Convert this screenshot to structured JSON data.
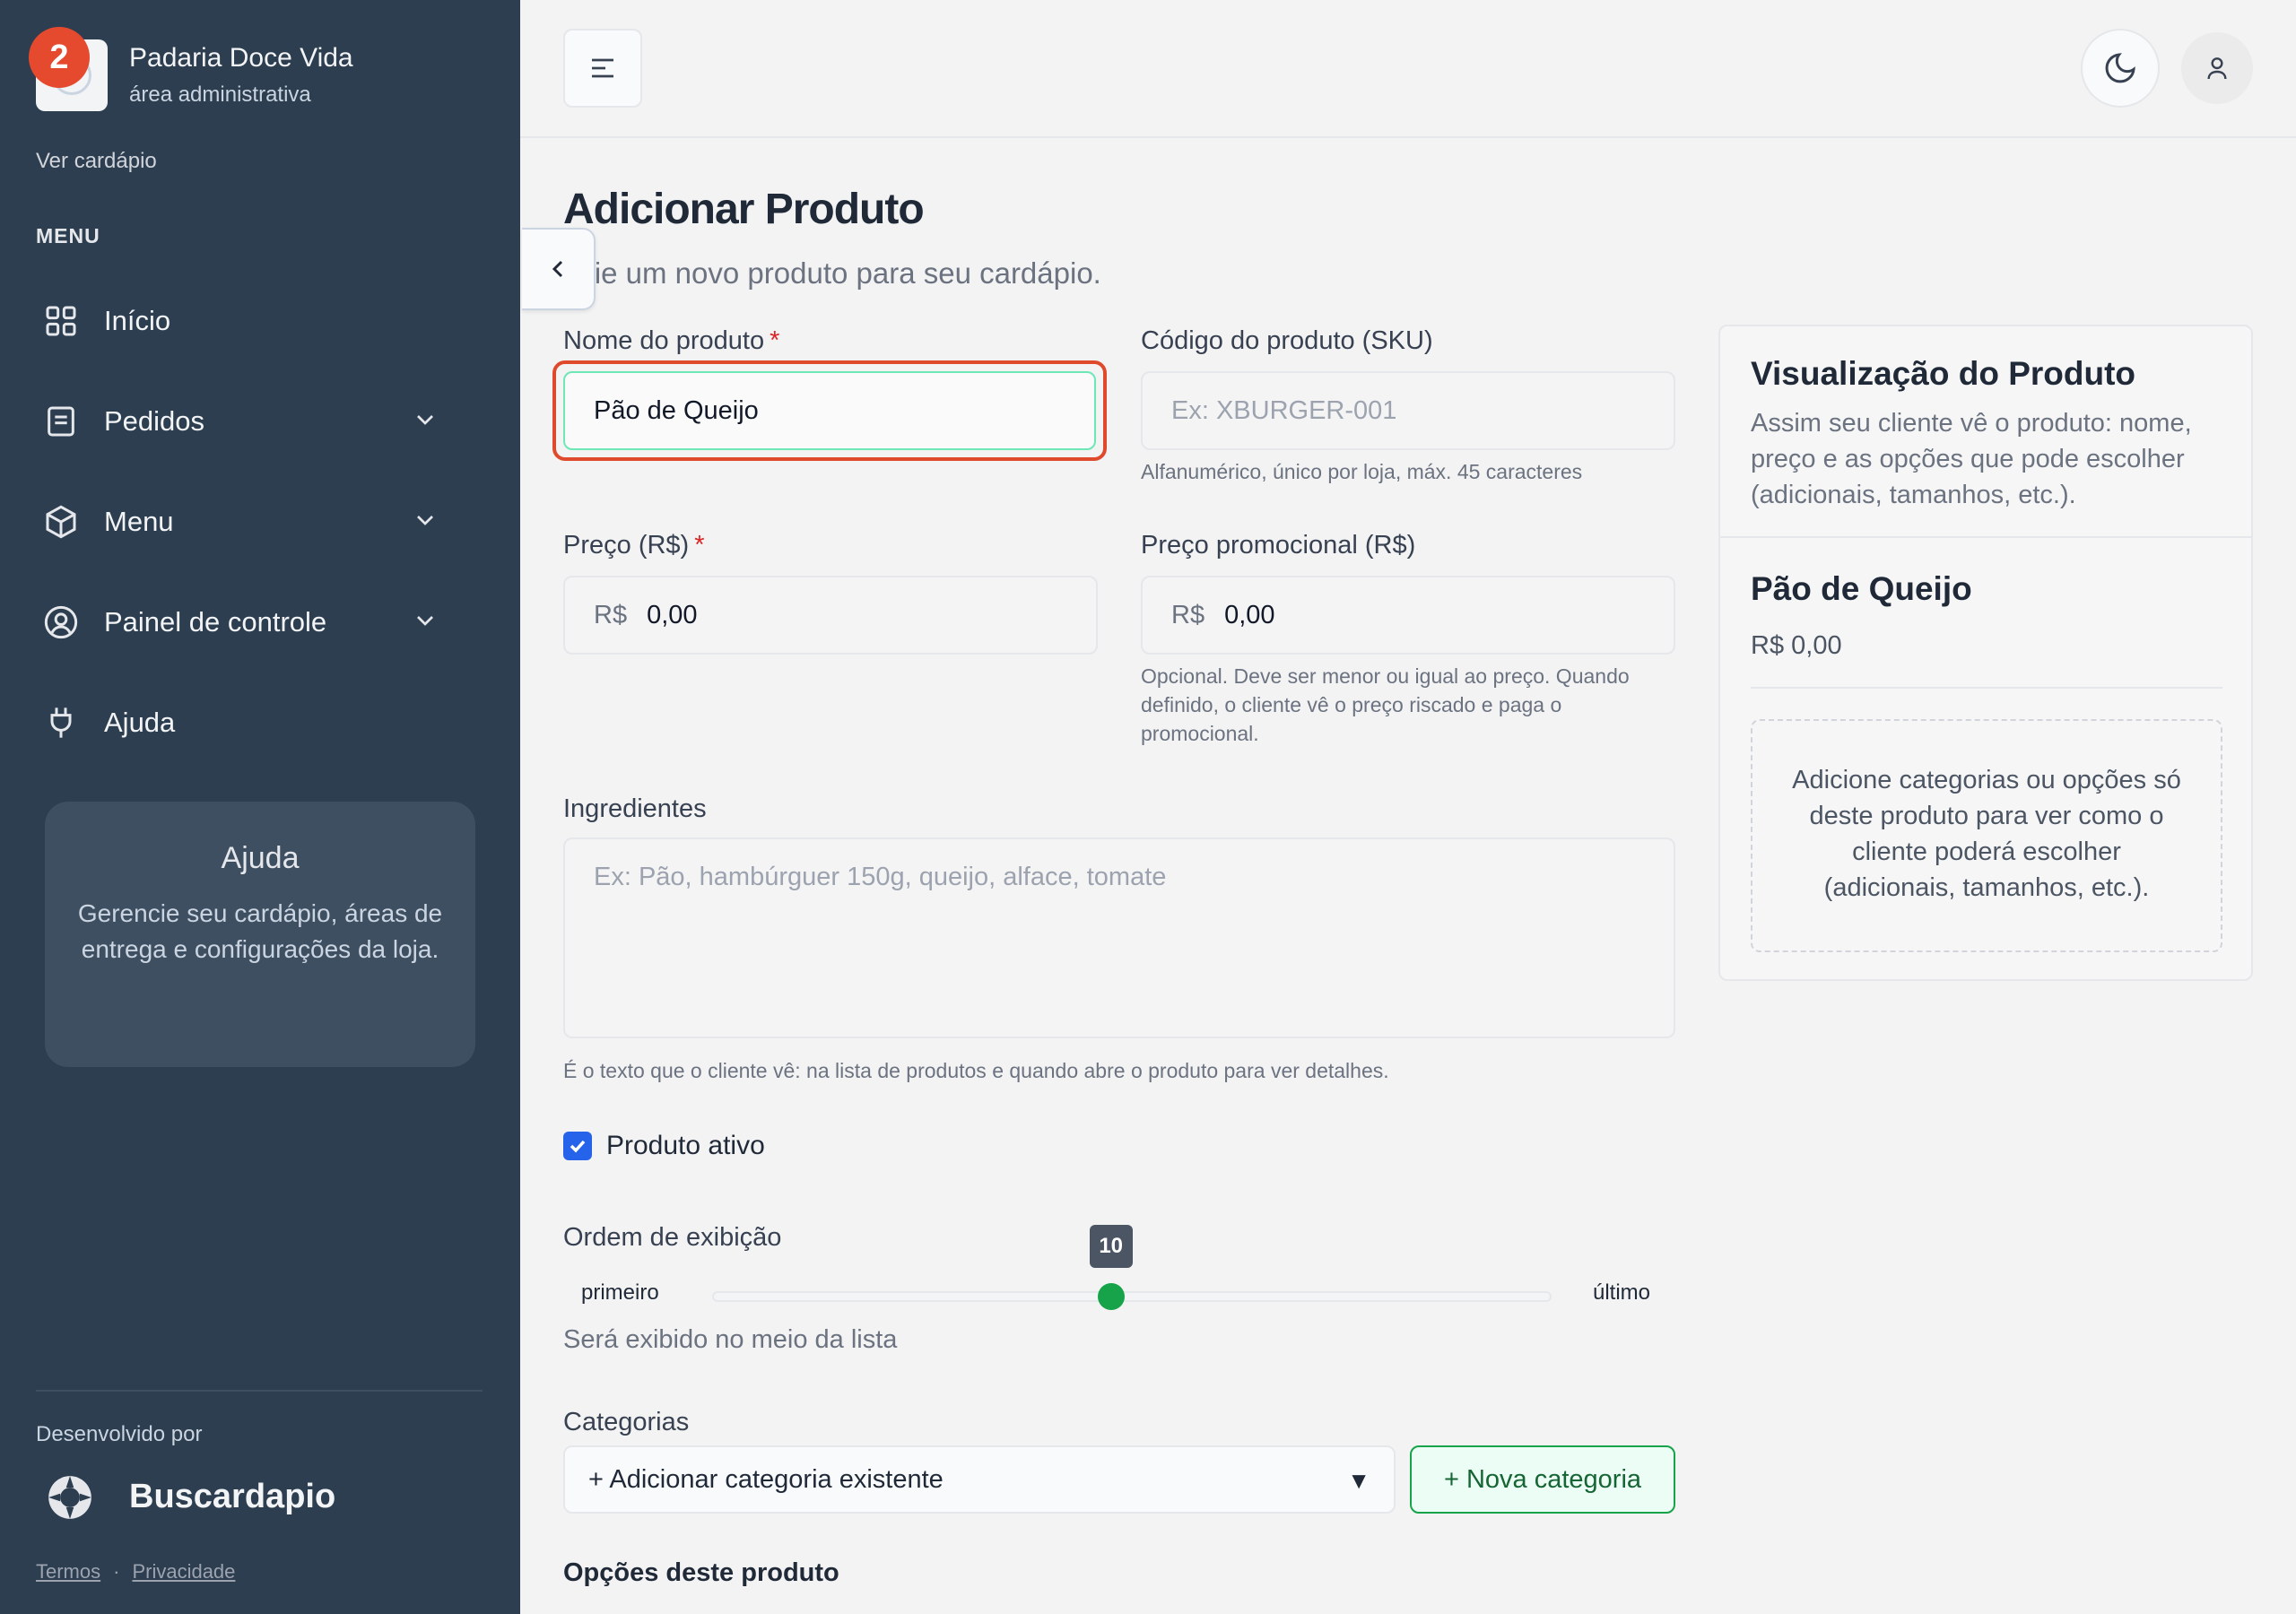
{
  "sidebar": {
    "store_name": "Padaria Doce Vida",
    "store_sub": "área administrativa",
    "notification_count": "2",
    "view_menu": "Ver cardápio",
    "menu_heading": "MENU",
    "items": [
      {
        "label": "Início",
        "icon": "grid-icon"
      },
      {
        "label": "Pedidos",
        "icon": "document-icon"
      },
      {
        "label": "Menu",
        "icon": "box-icon"
      },
      {
        "label": "Painel de controle",
        "icon": "user-circle-icon"
      },
      {
        "label": "Ajuda",
        "icon": "plug-icon"
      }
    ],
    "help": {
      "title": "Ajuda",
      "text": "Gerencie seu cardápio, áreas de entrega e configurações da loja."
    },
    "developed_by": "Desenvolvido por",
    "brand": "Buscardapio",
    "terms": "Termos",
    "privacy": "Privacidade",
    "separator": "·"
  },
  "page": {
    "title": "Adicionar Produto",
    "subtitle": "Crie um novo produto para seu cardápio."
  },
  "form": {
    "name": {
      "label": "Nome do produto",
      "required": "*",
      "value": "Pão de Queijo"
    },
    "sku": {
      "label": "Código do produto (SKU)",
      "placeholder": "Ex: XBURGER-001",
      "hint": "Alfanumérico, único por loja, máx. 45 caracteres"
    },
    "price": {
      "label": "Preço (R$)",
      "required": "*",
      "prefix": "R$",
      "value": "0,00"
    },
    "promo_price": {
      "label": "Preço promocional (R$)",
      "prefix": "R$",
      "value": "0,00",
      "hint": "Opcional. Deve ser menor ou igual ao preço. Quando definido, o cliente vê o preço riscado e paga o promocional."
    },
    "ingredients": {
      "label": "Ingredientes",
      "placeholder": "Ex: Pão, hambúrguer 150g, queijo, alface, tomate",
      "hint": "É o texto que o cliente vê: na lista de produtos e quando abre o produto para ver detalhes."
    },
    "active": {
      "label": "Produto ativo",
      "checked": true
    },
    "display_order": {
      "label": "Ordem de exibição",
      "min_label": "primeiro",
      "max_label": "último",
      "value": "10",
      "position_fraction": 0.475,
      "description": "Será exibido no meio da lista"
    },
    "categories": {
      "label": "Categorias",
      "select_value": "+ Adicionar categoria existente",
      "select_arrow": "▼",
      "new_button": "+ Nova categoria"
    },
    "options_title": "Opções deste produto"
  },
  "preview": {
    "title": "Visualização do Produto",
    "description": "Assim seu cliente vê o produto: nome, preço e as opções que pode escolher (adicionais, tamanhos, etc.).",
    "product_name": "Pão de Queijo",
    "product_price": "R$ 0,00",
    "empty_text": "Adicione categorias ou opções só deste produto para ver como o cliente poderá escolher (adicionais, tamanhos, etc.)."
  },
  "colors": {
    "sidebar_bg": "#2c3e50",
    "accent_green": "#16a34a",
    "focus_red": "#e04a2c",
    "checkbox_blue": "#2563eb"
  }
}
